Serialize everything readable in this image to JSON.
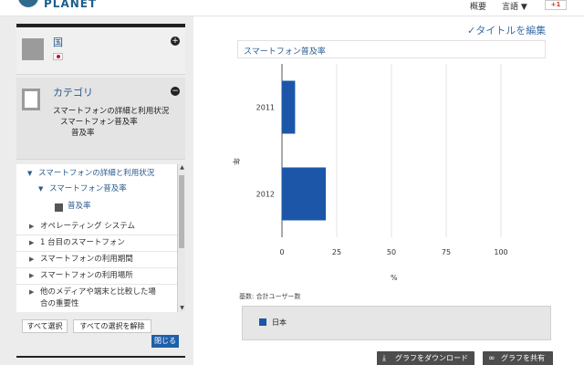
{
  "header": {
    "logo_text": "PLANET",
    "nav_overview": "概要",
    "nav_language": "言語 ▼",
    "gplus_label": "+1"
  },
  "left": {
    "country": {
      "title": "国"
    },
    "category": {
      "title": "カテゴリ",
      "lines": [
        "スマートフォンの詳細と利用状況",
        "スマートフォン普及率",
        "普及率"
      ]
    },
    "tree": {
      "head": "スマートフォンの詳細と利用状況",
      "sub": "スマートフォン普及率",
      "leaf": "普及率",
      "items": [
        "オペレーティング システム",
        "1 台目のスマートフォン",
        "スマートフォンの利用期間",
        "スマートフォンの利用場所",
        "他のメディアや端末と比較した場",
        "合の重要性"
      ]
    },
    "buttons": {
      "select_all": "すべて選択",
      "deselect_all": "すべての選択を解除",
      "close": "閉じる"
    }
  },
  "right": {
    "edit_title": "タイトルを編集",
    "chart_title": "スマートフォン普及率",
    "unit_label": "基数: 合計ユーザー数",
    "legend": {
      "label": "日本",
      "color": "#1b56a8"
    },
    "buttons": {
      "download": "グラフをダウンロード",
      "share": "グラフを共有"
    }
  },
  "chart_data": {
    "type": "bar",
    "orientation": "horizontal",
    "categories": [
      "2011",
      "2012"
    ],
    "series": [
      {
        "name": "日本",
        "values": [
          6,
          20
        ]
      }
    ],
    "xlim": [
      0,
      100
    ],
    "xticks": [
      0,
      25,
      50,
      75,
      100
    ],
    "xlabel": "%",
    "ylabel": "年",
    "grid": true,
    "color": "#1b56a8"
  }
}
